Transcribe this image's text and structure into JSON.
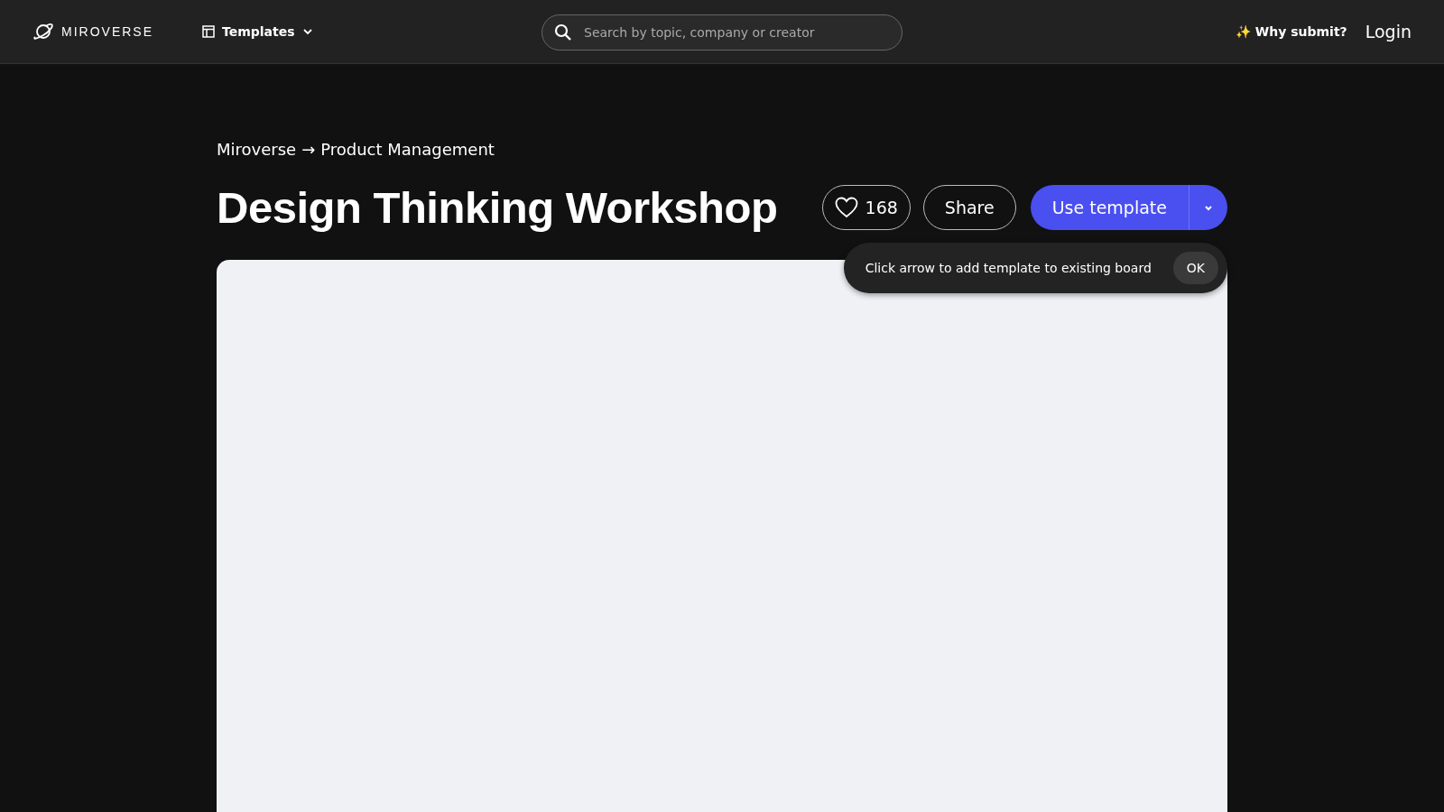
{
  "header": {
    "logo": "MIROVERSE",
    "templates_menu": "Templates",
    "search": {
      "placeholder": "Search by topic, company or creator"
    },
    "why_submit": "✨ Why submit?",
    "login": "Login"
  },
  "breadcrumb": {
    "items": [
      "Miroverse",
      "Product Management"
    ],
    "separator": "→"
  },
  "title": "Design Thinking Workshop",
  "actions": {
    "likes": "168",
    "share": "Share",
    "use_template": "Use template"
  },
  "tooltip": {
    "text": "Click arrow to add template to existing board",
    "button": "OK"
  }
}
